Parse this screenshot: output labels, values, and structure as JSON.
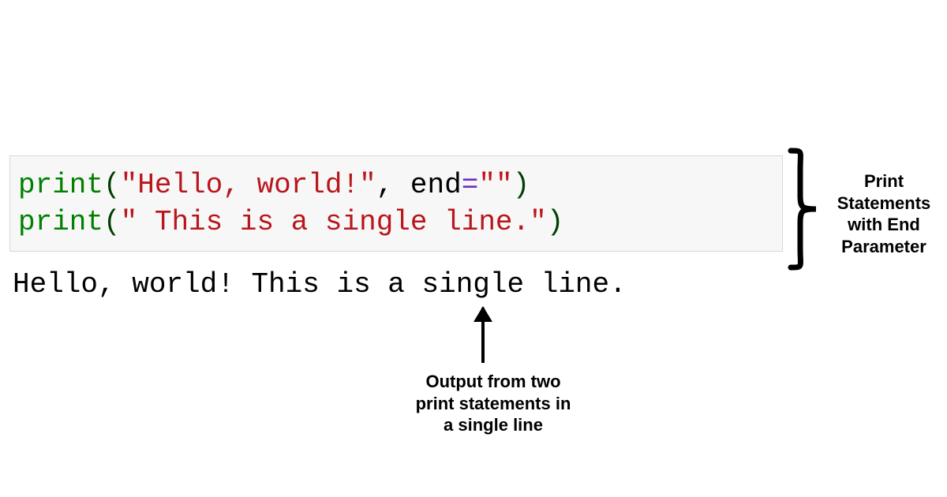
{
  "code": {
    "line1": {
      "fn": "print",
      "open": "(",
      "str": "\"Hello, world!\"",
      "comma": ", ",
      "kw": "end",
      "op": "=",
      "val": "\"\"",
      "close": ")"
    },
    "line2": {
      "fn": "print",
      "open": "(",
      "str": "\" This is a single line.\"",
      "close": ")"
    }
  },
  "output": "Hello, world! This is a single line.",
  "captions": {
    "right": "Print Statements with End Parameter",
    "bottom": "Output from two print statements in a single line"
  },
  "colors": {
    "function": "#008000",
    "string": "#b8161c",
    "operator": "#6c2fbd",
    "code_bg": "#f7f7f7"
  }
}
